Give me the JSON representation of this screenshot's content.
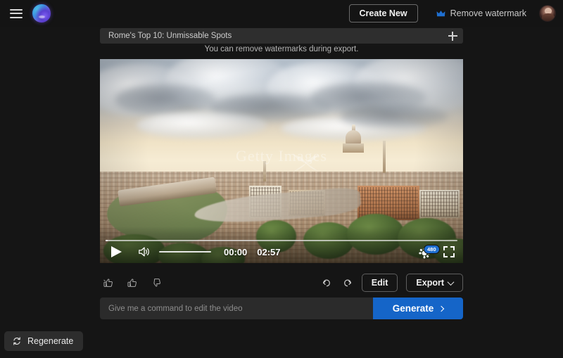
{
  "app": {
    "background": "#151515",
    "accent_blue": "#1565c8",
    "badge_blue": "#1f6fd0"
  },
  "topbar": {
    "menu_icon": "hamburger-menu-icon",
    "logo_icon": "app-logo-icon",
    "create_new_label": "Create New",
    "remove_watermark_label": "Remove watermark",
    "crown_icon": "crown-icon",
    "avatar_icon": "user-avatar"
  },
  "tabbar": {
    "title": "Rome's Top 10: Unmissable Spots",
    "add_icon": "plus-icon"
  },
  "notice": {
    "text": "You can remove watermarks during export."
  },
  "video": {
    "watermark_text": "Getty Images",
    "controls": {
      "play_icon": "play-icon",
      "volume_icon": "volume-icon",
      "current_time": "00:00",
      "duration": "02:57",
      "quality_label": "480",
      "settings_icon": "gear-icon",
      "fullscreen_icon": "fullscreen-icon",
      "progress_percent": 0.6
    }
  },
  "actions": {
    "clap_icon": "thumbs-up-outline-icon",
    "like_icon": "thumbs-up-icon",
    "dislike_icon": "thumbs-down-icon",
    "undo_icon": "undo-icon",
    "redo_icon": "redo-icon",
    "edit_label": "Edit",
    "export_label": "Export",
    "export_chevron_icon": "chevron-down-icon"
  },
  "command": {
    "placeholder": "Give me a command to edit the video",
    "value": "",
    "generate_label": "Generate",
    "generate_chevron_icon": "chevron-right-icon"
  },
  "footer": {
    "regenerate_label": "Regenerate",
    "regenerate_icon": "refresh-icon"
  }
}
